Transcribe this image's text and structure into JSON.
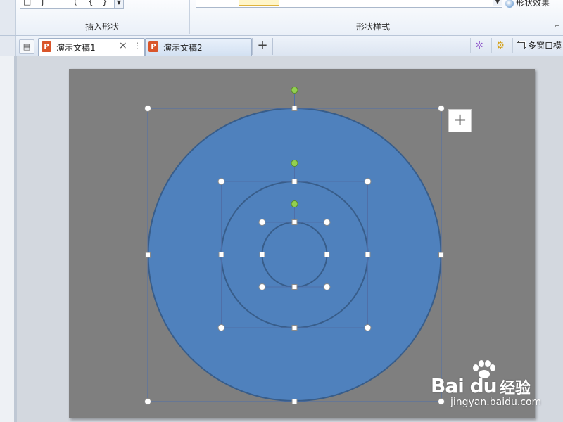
{
  "ribbon": {
    "insert_shapes_label": "插入形状",
    "shape_styles_label": "形状样式",
    "shape_effects_label": "形状效果",
    "launcher_glyph": "⌐"
  },
  "tabs": [
    {
      "label": "演示文稿1",
      "active": true,
      "icon": "P"
    },
    {
      "label": "演示文稿2",
      "active": false,
      "icon": "P"
    }
  ],
  "tabbar": {
    "add_tab_glyph": "+",
    "close_glyph": "×",
    "more_glyph": "⋮",
    "multi_window_label": "多窗口模"
  },
  "slide": {
    "background_color": "#7f7f7f",
    "circle_fill_color": "#4f81bd",
    "circle_outline_color": "#385d8a",
    "selection_color": "#4f6fa8",
    "rotation_handle_color": "#92d050",
    "plus_button_glyph": "+"
  },
  "watermark": {
    "logo": "Bai du",
    "brand": "经验",
    "url": "jingyan.baidu.com"
  }
}
